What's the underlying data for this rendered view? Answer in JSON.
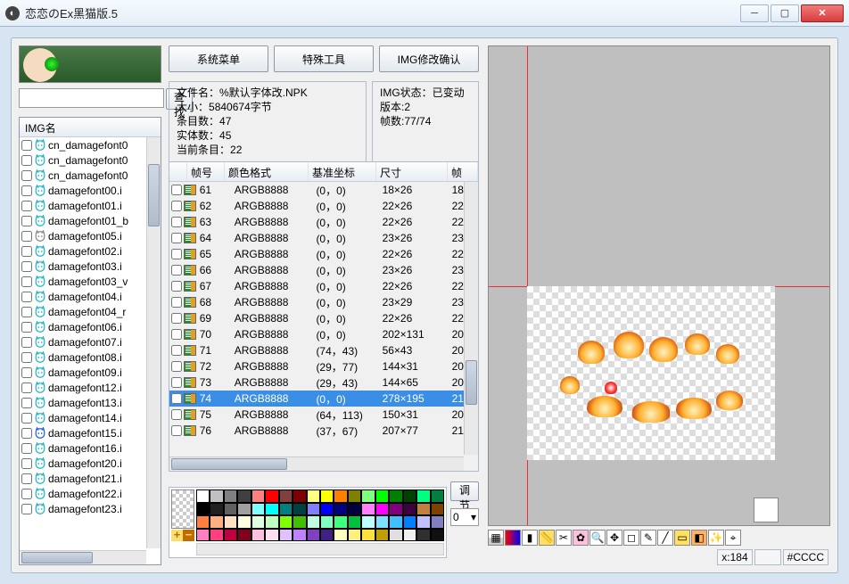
{
  "window": {
    "title": "恋恋のEx黑猫版.5"
  },
  "buttons": {
    "search": "查找",
    "menu1": "系统菜单",
    "menu2": "特殊工具",
    "menu3": "IMG修改确认",
    "adjust": "调节"
  },
  "imglist": {
    "header": "IMG名",
    "items": [
      {
        "name": "cn_damagefont0",
        "variant": "cyan"
      },
      {
        "name": "cn_damagefont0",
        "variant": "cyan"
      },
      {
        "name": "cn_damagefont0",
        "variant": "cyan"
      },
      {
        "name": "damagefont00.i",
        "variant": "cyan"
      },
      {
        "name": "damagefont01.i",
        "variant": "cyan"
      },
      {
        "name": "damagefont01_b",
        "variant": "cyan"
      },
      {
        "name": "damagefont05.i",
        "variant": "gray"
      },
      {
        "name": "damagefont02.i",
        "variant": "cyan"
      },
      {
        "name": "damagefont03.i",
        "variant": "cyan"
      },
      {
        "name": "damagefont03_v",
        "variant": "cyan"
      },
      {
        "name": "damagefont04.i",
        "variant": "cyan"
      },
      {
        "name": "damagefont04_r",
        "variant": "cyan"
      },
      {
        "name": "damagefont06.i",
        "variant": "cyan"
      },
      {
        "name": "damagefont07.i",
        "variant": "cyan"
      },
      {
        "name": "damagefont08.i",
        "variant": "cyan"
      },
      {
        "name": "damagefont09.i",
        "variant": "cyan"
      },
      {
        "name": "damagefont12.i",
        "variant": "cyan"
      },
      {
        "name": "damagefont13.i",
        "variant": "cyan"
      },
      {
        "name": "damagefont14.i",
        "variant": "cyan"
      },
      {
        "name": "damagefont15.i",
        "variant": "blue"
      },
      {
        "name": "damagefont16.i",
        "variant": "cyan"
      },
      {
        "name": "damagefont20.i",
        "variant": "cyan"
      },
      {
        "name": "damagefont21.i",
        "variant": "cyan"
      },
      {
        "name": "damagefont22.i",
        "variant": "cyan"
      },
      {
        "name": "damagefont23.i",
        "variant": "cyan"
      }
    ]
  },
  "fileinfo": {
    "filename_label": "文件名：",
    "filename": "%默认字体改.NPK",
    "size_label": "大小：",
    "size": "5840674字节",
    "entries_label": "条目数：",
    "entries": "47",
    "real_label": "实体数：",
    "real": "45",
    "current_label": "当前条目：",
    "current": "22"
  },
  "imgstate": {
    "state_label": "IMG状态：",
    "state": "已变动",
    "ver_label": "版本:",
    "ver": "2",
    "frames_label": "帧数:",
    "frames": "77/74"
  },
  "frames": {
    "cols": {
      "id": "帧号",
      "fmt": "颜色格式",
      "xy": "基准坐标",
      "sz": "尺寸",
      "ex": "帧"
    },
    "rows": [
      {
        "id": "61",
        "fmt": "ARGB8888",
        "xy": "(0，0)",
        "sz": "18×26",
        "ex": "18"
      },
      {
        "id": "62",
        "fmt": "ARGB8888",
        "xy": "(0，0)",
        "sz": "22×26",
        "ex": "22"
      },
      {
        "id": "63",
        "fmt": "ARGB8888",
        "xy": "(0，0)",
        "sz": "22×26",
        "ex": "22"
      },
      {
        "id": "64",
        "fmt": "ARGB8888",
        "xy": "(0，0)",
        "sz": "23×26",
        "ex": "23"
      },
      {
        "id": "65",
        "fmt": "ARGB8888",
        "xy": "(0，0)",
        "sz": "22×26",
        "ex": "22"
      },
      {
        "id": "66",
        "fmt": "ARGB8888",
        "xy": "(0，0)",
        "sz": "23×26",
        "ex": "23"
      },
      {
        "id": "67",
        "fmt": "ARGB8888",
        "xy": "(0，0)",
        "sz": "22×26",
        "ex": "22"
      },
      {
        "id": "68",
        "fmt": "ARGB8888",
        "xy": "(0，0)",
        "sz": "23×29",
        "ex": "23"
      },
      {
        "id": "69",
        "fmt": "ARGB8888",
        "xy": "(0，0)",
        "sz": "22×26",
        "ex": "22"
      },
      {
        "id": "70",
        "fmt": "ARGB8888",
        "xy": "(0，0)",
        "sz": "202×131",
        "ex": "20"
      },
      {
        "id": "71",
        "fmt": "ARGB8888",
        "xy": "(74，43)",
        "sz": "56×43",
        "ex": "20"
      },
      {
        "id": "72",
        "fmt": "ARGB8888",
        "xy": "(29，77)",
        "sz": "144×31",
        "ex": "20"
      },
      {
        "id": "73",
        "fmt": "ARGB8888",
        "xy": "(29，43)",
        "sz": "144×65",
        "ex": "20"
      },
      {
        "id": "74",
        "fmt": "ARGB8888",
        "xy": "(0，0)",
        "sz": "278×195",
        "ex": "21",
        "sel": true
      },
      {
        "id": "75",
        "fmt": "ARGB8888",
        "xy": "(64，113)",
        "sz": "150×31",
        "ex": "20"
      },
      {
        "id": "76",
        "fmt": "ARGB8888",
        "xy": "(37，67)",
        "sz": "207×77",
        "ex": "21"
      }
    ]
  },
  "palette": [
    "#ffffff",
    "#c0c0c0",
    "#808080",
    "#404040",
    "#ff8080",
    "#ff0000",
    "#804040",
    "#800000",
    "#ffff80",
    "#ffff00",
    "#ff8000",
    "#808000",
    "#80ff80",
    "#00ff00",
    "#008000",
    "#004000",
    "#00ff80",
    "#008040",
    "#000000",
    "#202020",
    "#606060",
    "#a0a0a0",
    "#80ffff",
    "#00ffff",
    "#008080",
    "#004040",
    "#8080ff",
    "#0000ff",
    "#000080",
    "#000040",
    "#ff80ff",
    "#ff00ff",
    "#800080",
    "#400040",
    "#c08040",
    "#804000",
    "#ff8040",
    "#ffb080",
    "#ffe0c0",
    "#ffffe0",
    "#e0ffe0",
    "#c0ffc0",
    "#80ff00",
    "#40c000",
    "#c0ffe0",
    "#80ffc0",
    "#40ff80",
    "#00c040",
    "#c0ffff",
    "#80e0ff",
    "#40c0ff",
    "#0080ff",
    "#c0c0ff",
    "#8080c0",
    "#ff80c0",
    "#ff4080",
    "#c00040",
    "#800020",
    "#ffc0e0",
    "#ffe0f0",
    "#e0c0ff",
    "#c080ff",
    "#8040c0",
    "#402080",
    "#ffffc0",
    "#fff080",
    "#ffe040",
    "#c0a000",
    "#e0e0e0",
    "#f0f0f0",
    "#303030",
    "#101010"
  ],
  "zero_select": "0",
  "status": {
    "coord_label": "x:",
    "coord": "184",
    "color": "#CCCC"
  },
  "tools": [
    {
      "name": "tool-grid",
      "bg": "linear-gradient(#fff 50%,#ccc 50%)",
      "g": "▦"
    },
    {
      "name": "tool-rgb",
      "bg": "linear-gradient(90deg,#f00,#00f)",
      "g": ""
    },
    {
      "name": "tool-levels",
      "bg": "#fff",
      "g": "▮"
    },
    {
      "name": "tool-ruler",
      "bg": "#ffe060",
      "g": "📏"
    },
    {
      "name": "tool-cut",
      "bg": "#fff",
      "g": "✂"
    },
    {
      "name": "tool-flower",
      "bg": "#ffc0e0",
      "g": "✿"
    },
    {
      "name": "tool-zoom",
      "bg": "#fff",
      "g": "🔍"
    },
    {
      "name": "tool-move",
      "bg": "#fff",
      "g": "✥"
    },
    {
      "name": "tool-crop",
      "bg": "#fff",
      "g": "◻"
    },
    {
      "name": "tool-pencil",
      "bg": "#fff",
      "g": "✎"
    },
    {
      "name": "tool-line",
      "bg": "#fff",
      "g": "╱"
    },
    {
      "name": "tool-box",
      "bg": "#ffe060",
      "g": "▭"
    },
    {
      "name": "tool-fill",
      "bg": "#ffb060",
      "g": "◧"
    },
    {
      "name": "tool-wand",
      "bg": "#fff",
      "g": "✨"
    },
    {
      "name": "tool-pick",
      "bg": "#fff",
      "g": "⌖"
    }
  ]
}
